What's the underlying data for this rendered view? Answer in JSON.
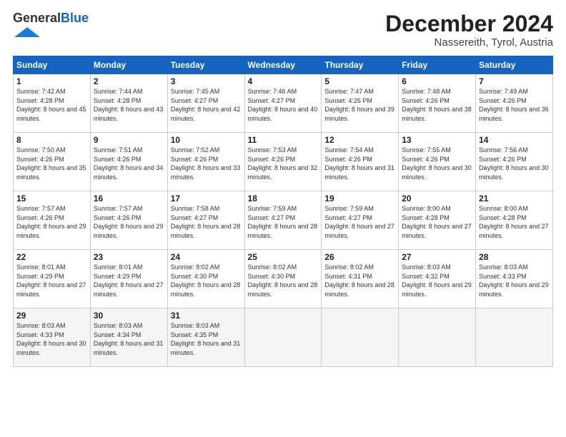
{
  "header": {
    "logo_general": "General",
    "logo_blue": "Blue",
    "month_title": "December 2024",
    "location": "Nassereith, Tyrol, Austria"
  },
  "days_of_week": [
    "Sunday",
    "Monday",
    "Tuesday",
    "Wednesday",
    "Thursday",
    "Friday",
    "Saturday"
  ],
  "weeks": [
    [
      {
        "day": "1",
        "sunrise": "7:42 AM",
        "sunset": "4:28 PM",
        "daylight": "8 hours and 45 minutes."
      },
      {
        "day": "2",
        "sunrise": "7:44 AM",
        "sunset": "4:28 PM",
        "daylight": "8 hours and 43 minutes."
      },
      {
        "day": "3",
        "sunrise": "7:45 AM",
        "sunset": "4:27 PM",
        "daylight": "8 hours and 42 minutes."
      },
      {
        "day": "4",
        "sunrise": "7:46 AM",
        "sunset": "4:27 PM",
        "daylight": "8 hours and 40 minutes."
      },
      {
        "day": "5",
        "sunrise": "7:47 AM",
        "sunset": "4:26 PM",
        "daylight": "8 hours and 39 minutes."
      },
      {
        "day": "6",
        "sunrise": "7:48 AM",
        "sunset": "4:26 PM",
        "daylight": "8 hours and 38 minutes."
      },
      {
        "day": "7",
        "sunrise": "7:49 AM",
        "sunset": "4:26 PM",
        "daylight": "8 hours and 36 minutes."
      }
    ],
    [
      {
        "day": "8",
        "sunrise": "7:50 AM",
        "sunset": "4:26 PM",
        "daylight": "8 hours and 35 minutes."
      },
      {
        "day": "9",
        "sunrise": "7:51 AM",
        "sunset": "4:26 PM",
        "daylight": "8 hours and 34 minutes."
      },
      {
        "day": "10",
        "sunrise": "7:52 AM",
        "sunset": "4:26 PM",
        "daylight": "8 hours and 33 minutes."
      },
      {
        "day": "11",
        "sunrise": "7:53 AM",
        "sunset": "4:26 PM",
        "daylight": "8 hours and 32 minutes."
      },
      {
        "day": "12",
        "sunrise": "7:54 AM",
        "sunset": "4:26 PM",
        "daylight": "8 hours and 31 minutes."
      },
      {
        "day": "13",
        "sunrise": "7:55 AM",
        "sunset": "4:26 PM",
        "daylight": "8 hours and 30 minutes."
      },
      {
        "day": "14",
        "sunrise": "7:56 AM",
        "sunset": "4:26 PM",
        "daylight": "8 hours and 30 minutes."
      }
    ],
    [
      {
        "day": "15",
        "sunrise": "7:57 AM",
        "sunset": "4:26 PM",
        "daylight": "8 hours and 29 minutes."
      },
      {
        "day": "16",
        "sunrise": "7:57 AM",
        "sunset": "4:26 PM",
        "daylight": "8 hours and 29 minutes."
      },
      {
        "day": "17",
        "sunrise": "7:58 AM",
        "sunset": "4:27 PM",
        "daylight": "8 hours and 28 minutes."
      },
      {
        "day": "18",
        "sunrise": "7:59 AM",
        "sunset": "4:27 PM",
        "daylight": "8 hours and 28 minutes."
      },
      {
        "day": "19",
        "sunrise": "7:59 AM",
        "sunset": "4:27 PM",
        "daylight": "8 hours and 27 minutes."
      },
      {
        "day": "20",
        "sunrise": "8:00 AM",
        "sunset": "4:28 PM",
        "daylight": "8 hours and 27 minutes."
      },
      {
        "day": "21",
        "sunrise": "8:00 AM",
        "sunset": "4:28 PM",
        "daylight": "8 hours and 27 minutes."
      }
    ],
    [
      {
        "day": "22",
        "sunrise": "8:01 AM",
        "sunset": "4:29 PM",
        "daylight": "8 hours and 27 minutes."
      },
      {
        "day": "23",
        "sunrise": "8:01 AM",
        "sunset": "4:29 PM",
        "daylight": "8 hours and 27 minutes."
      },
      {
        "day": "24",
        "sunrise": "8:02 AM",
        "sunset": "4:30 PM",
        "daylight": "8 hours and 28 minutes."
      },
      {
        "day": "25",
        "sunrise": "8:02 AM",
        "sunset": "4:30 PM",
        "daylight": "8 hours and 28 minutes."
      },
      {
        "day": "26",
        "sunrise": "8:02 AM",
        "sunset": "4:31 PM",
        "daylight": "8 hours and 28 minutes."
      },
      {
        "day": "27",
        "sunrise": "8:03 AM",
        "sunset": "4:32 PM",
        "daylight": "8 hours and 29 minutes."
      },
      {
        "day": "28",
        "sunrise": "8:03 AM",
        "sunset": "4:33 PM",
        "daylight": "8 hours and 29 minutes."
      }
    ],
    [
      {
        "day": "29",
        "sunrise": "8:03 AM",
        "sunset": "4:33 PM",
        "daylight": "8 hours and 30 minutes."
      },
      {
        "day": "30",
        "sunrise": "8:03 AM",
        "sunset": "4:34 PM",
        "daylight": "8 hours and 31 minutes."
      },
      {
        "day": "31",
        "sunrise": "8:03 AM",
        "sunset": "4:35 PM",
        "daylight": "8 hours and 31 minutes."
      },
      null,
      null,
      null,
      null
    ]
  ],
  "labels": {
    "sunrise": "Sunrise:",
    "sunset": "Sunset:",
    "daylight": "Daylight:"
  }
}
